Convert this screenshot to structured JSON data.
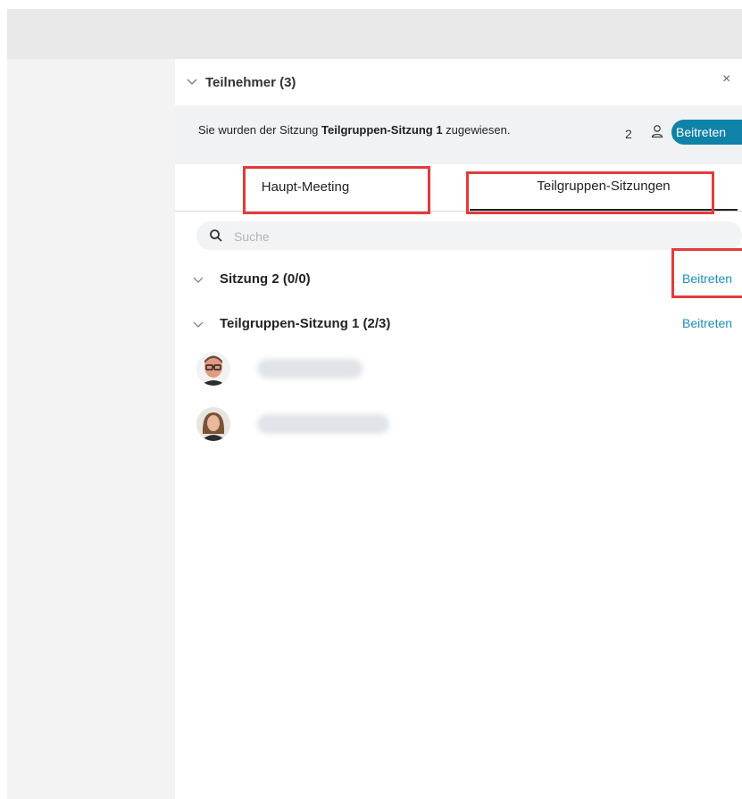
{
  "panel": {
    "title": "Teilnehmer (3)",
    "close_label": "×"
  },
  "notice": {
    "text_prefix": "Sie wurden der Sitzung ",
    "session_name": "Teilgruppen-Sitzung 1",
    "text_suffix": " zugewiesen.",
    "count": "2",
    "join_label": "Beitreten"
  },
  "tabs": [
    {
      "label": "Haupt-Meeting",
      "selected": false
    },
    {
      "label": "Teilgruppen-Sitzungen",
      "selected": true
    }
  ],
  "search": {
    "placeholder": "Suche",
    "value": ""
  },
  "sessions": [
    {
      "name": "Sitzung 2 (0/0)",
      "join_label": "Beitreten"
    },
    {
      "name": "Teilgruppen-Sitzung 1 (2/3)",
      "join_label": "Beitreten"
    }
  ],
  "colors": {
    "accent": "#0f82a8",
    "link": "#1a8fbf",
    "highlight": "#e23b3b"
  },
  "icons": {
    "header_chevron": "chevron-down-icon",
    "close": "close-icon",
    "person": "person-icon",
    "search": "search-icon",
    "session_chevron": "chevron-down-icon"
  }
}
